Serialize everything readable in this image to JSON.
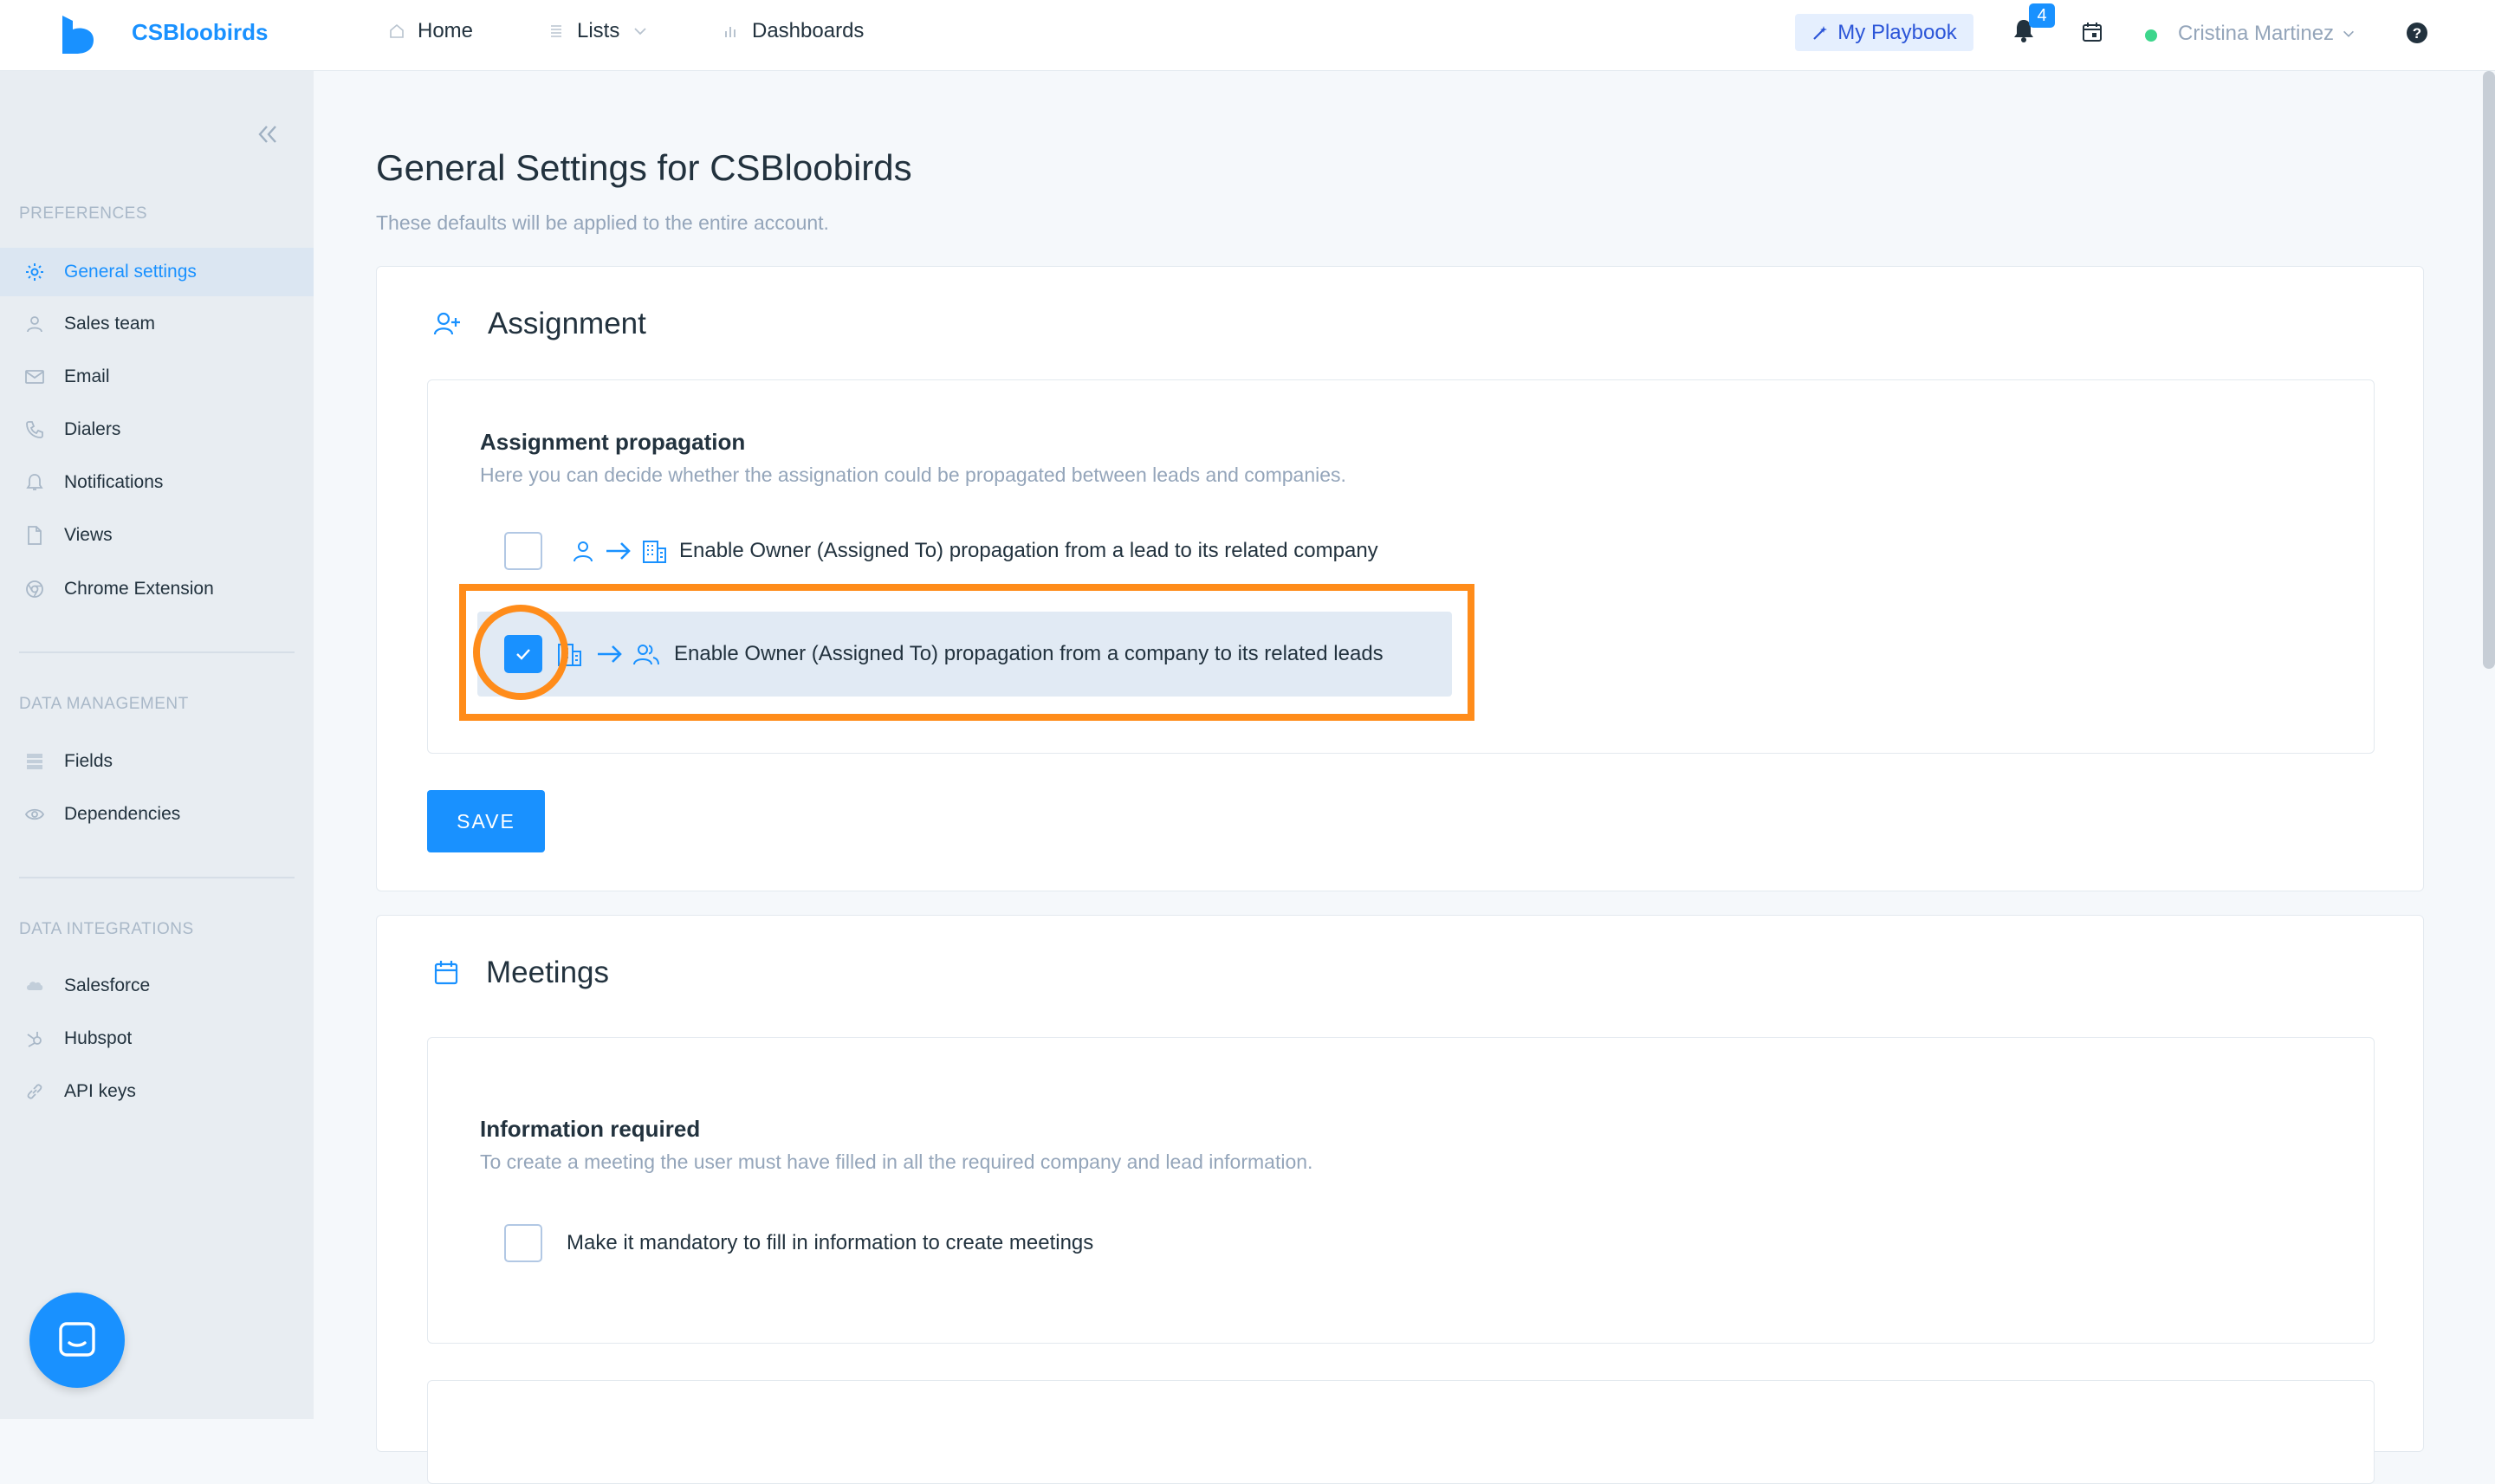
{
  "app": {
    "brand": "CSBloobirds"
  },
  "nav": {
    "home": "Home",
    "lists": "Lists",
    "dashboards": "Dashboards"
  },
  "topbar": {
    "playbook": "My Playbook",
    "notifications_count": "4",
    "user_name": "Cristina Martinez",
    "status_color": "#3dd68c"
  },
  "sidebar": {
    "sections": [
      {
        "title": "PREFERENCES",
        "items": [
          "General settings",
          "Sales team",
          "Email",
          "Dialers",
          "Notifications",
          "Views",
          "Chrome Extension"
        ]
      },
      {
        "title": "DATA MANAGEMENT",
        "items": [
          "Fields",
          "Dependencies"
        ]
      },
      {
        "title": "DATA INTEGRATIONS",
        "items": [
          "Salesforce",
          "Hubspot",
          "API keys"
        ]
      }
    ],
    "active": "General settings"
  },
  "page": {
    "title": "General Settings for CSBloobirds",
    "subtitle": "These defaults will be applied to the entire account."
  },
  "assignment": {
    "title": "Assignment",
    "propagation_title": "Assignment propagation",
    "propagation_desc": "Here you can decide whether the assignation could be propagated between leads and companies.",
    "option_lead_to_company": {
      "label": "Enable Owner (Assigned To) propagation from a lead to its related company",
      "checked": false
    },
    "option_company_to_leads": {
      "label": "Enable Owner (Assigned To) propagation from a company to its related leads",
      "checked": true
    },
    "save": "SAVE"
  },
  "meetings": {
    "title": "Meetings",
    "info_title": "Information required",
    "info_desc": "To create a meeting the user must have filled in all the required company and lead information.",
    "option_mandatory": {
      "label": "Make it mandatory to fill in information to create meetings",
      "checked": false
    }
  },
  "colors": {
    "accent": "#1991ff",
    "highlight": "#ff8c1a"
  }
}
